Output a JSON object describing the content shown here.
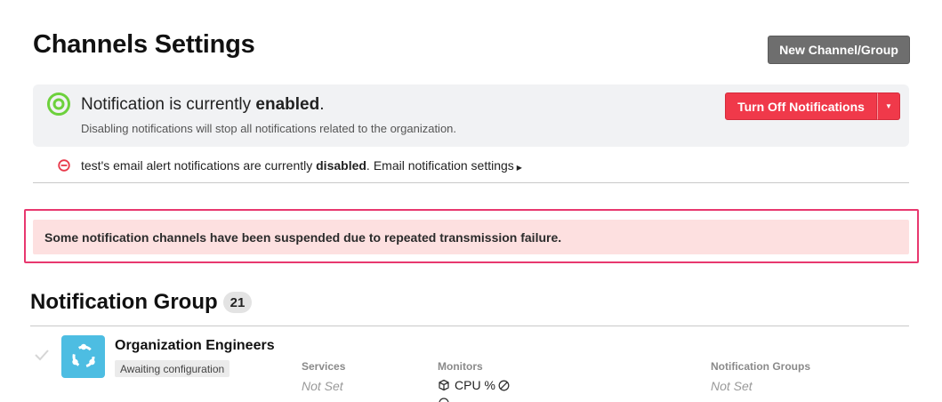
{
  "page": {
    "title": "Channels Settings",
    "new_button": "New Channel/Group"
  },
  "notification": {
    "headline_prefix": "Notification is currently ",
    "headline_status": "enabled",
    "headline_suffix": ".",
    "subtext": "Disabling notifications will stop all notifications related to the organization.",
    "turn_off_label": "Turn Off Notifications",
    "status_color": "#6dd13c"
  },
  "email_alert": {
    "prefix": "test's email alert notifications are currently ",
    "status": "disabled",
    "suffix": ".",
    "link_label": "Email notification settings",
    "icon_color": "#e8384a"
  },
  "alert": {
    "message": "Some notification channels have been suspended due to repeated transmission failure.",
    "outline_color": "#e8386f",
    "background_color": "#fde0e0"
  },
  "notification_group": {
    "title": "Notification Group",
    "count": "21",
    "items": [
      {
        "name": "Organization Engineers",
        "badge": "Awaiting configuration",
        "columns": {
          "services_label": "Services",
          "services_value": "Not Set",
          "monitors_label": "Monitors",
          "monitors": [
            "CPU %"
          ],
          "groups_label": "Notification Groups",
          "groups_value": "Not Set"
        }
      }
    ]
  },
  "colors": {
    "primary_danger": "#f0394a",
    "secondary_button": "#6e6e6e",
    "avatar_bg": "#4dbde2"
  }
}
